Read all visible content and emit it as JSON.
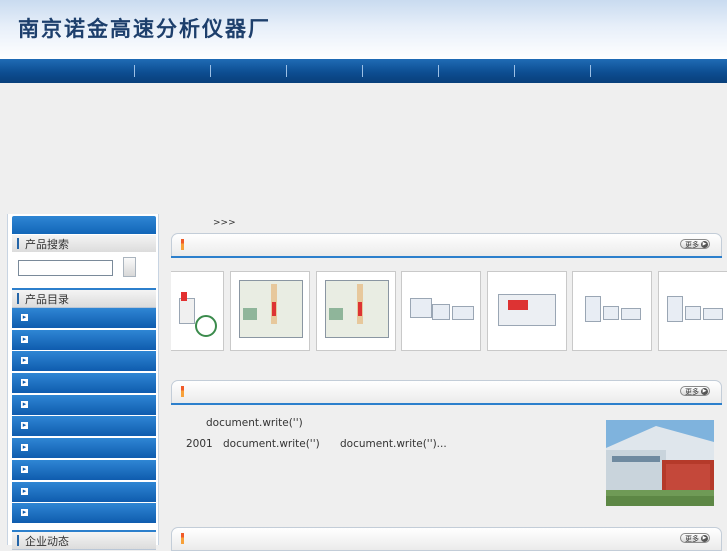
{
  "header": {
    "title": "南京诺金高速分析仪器厂"
  },
  "nav": {
    "items": [
      "",
      "",
      "",
      "",
      "",
      "",
      "",
      ""
    ]
  },
  "sidebar": {
    "search_title": "产品搜索",
    "search_placeholder": "",
    "catalog_title": "产品目录",
    "news_title": "企业动态",
    "category_arrow": "▸"
  },
  "main": {
    "breadcrumb": ">>>",
    "products_more": "更多",
    "news_more": "更多",
    "third_more": "更多",
    "news": {
      "line1": "document.write('')",
      "line2_year": "2001",
      "line2_a": "document.write('')",
      "line2_b": "document.write('')..."
    }
  },
  "colors": {
    "nav_blue": "#0d4e92",
    "accent_blue": "#2c7fcc",
    "title_blue": "#1d3f6c"
  }
}
